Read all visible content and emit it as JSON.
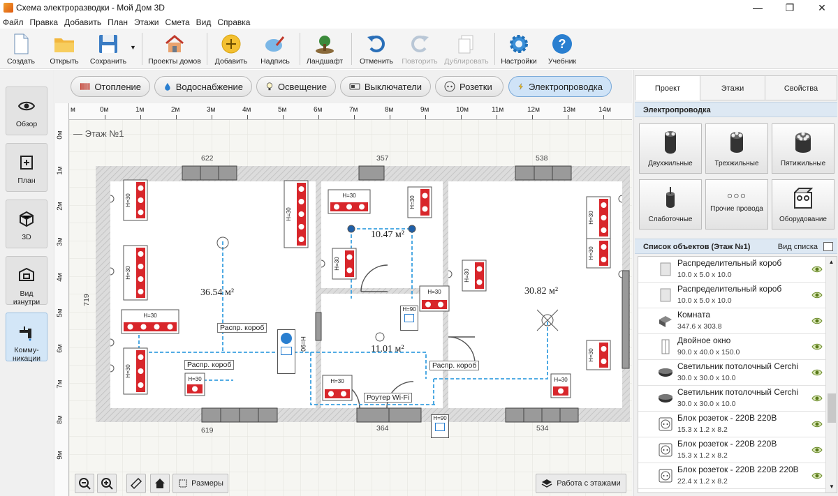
{
  "window": {
    "title": "Схема электроразводки - Мой Дом 3D",
    "minimize": "—",
    "maximize": "❐",
    "close": "✕"
  },
  "menu": [
    "Файл",
    "Правка",
    "Добавить",
    "План",
    "Этажи",
    "Смета",
    "Вид",
    "Справка"
  ],
  "toolbar": {
    "create": "Создать",
    "open": "Открыть",
    "save": "Сохранить",
    "projects": "Проекты домов",
    "add": "Добавить",
    "label": "Надпись",
    "landscape": "Ландшафт",
    "undo": "Отменить",
    "redo": "Повторить",
    "duplicate": "Дублировать",
    "settings": "Настройки",
    "tutorial": "Учебник"
  },
  "leftbar": {
    "overview": "Обзор",
    "plan": "План",
    "three_d": "3D",
    "inside_view": "Вид изнутри",
    "communications": "Комму-никации"
  },
  "categories": {
    "heating": "Отопление",
    "water": "Водоснабжение",
    "lighting": "Освещение",
    "switches": "Выключатели",
    "sockets": "Розетки",
    "wiring": "Электропроводка"
  },
  "ruler": {
    "unit": "м",
    "top": [
      "0м",
      "1м",
      "2м",
      "3м",
      "4м",
      "5м",
      "6м",
      "7м",
      "8м",
      "9м",
      "10м",
      "11м",
      "12м",
      "13м",
      "14м"
    ],
    "left": [
      "0м",
      "1м",
      "2м",
      "3м",
      "4м",
      "5м",
      "6м",
      "7м",
      "8м",
      "9м"
    ]
  },
  "plan": {
    "floor_label": "Этаж №1",
    "dims": {
      "top1": "622",
      "top2": "357",
      "top3": "538",
      "bottom1": "619",
      "bottom2": "364",
      "bottom3": "534",
      "left": "719"
    },
    "areas": [
      "36.54 м²",
      "10.47 м²",
      "11.01 м²",
      "30.82 м²"
    ],
    "box_labels": [
      "Распр. короб",
      "Распр. короб",
      "Распр. короб"
    ],
    "router_label": "Роутер Wi-Fi",
    "height_label": "H=30",
    "height_label_90": "H=90"
  },
  "bottom_tools": {
    "sizes": "Размеры",
    "floors_work": "Работа с этажами"
  },
  "right": {
    "tabs": {
      "project": "Проект",
      "floors": "Этажи",
      "properties": "Свойства"
    },
    "section_wiring": "Электропроводка",
    "wires": [
      "Двухжильные",
      "Трехжильные",
      "Пятижильные",
      "Слаботочные",
      "Прочие провода",
      "Оборудование"
    ],
    "list_header": "Список объектов (Этаж №1)",
    "list_view": "Вид списка",
    "objects": [
      {
        "name": "Распределительный короб",
        "dims": "10.0 x 5.0 x 10.0"
      },
      {
        "name": "Распределительный короб",
        "dims": "10.0 x 5.0 x 10.0"
      },
      {
        "name": "Комната",
        "dims": "347.6 x 303.8"
      },
      {
        "name": "Двойное окно",
        "dims": "90.0 x 40.0 x 150.0"
      },
      {
        "name": "Светильник потолочный Cerchi",
        "dims": "30.0 x 30.0 x 10.0"
      },
      {
        "name": "Светильник потолочный Cerchi",
        "dims": "30.0 x 30.0 x 10.0"
      },
      {
        "name": "Блок розеток - 220В 220В",
        "dims": "15.3 x 1.2 x 8.2"
      },
      {
        "name": "Блок розеток - 220В 220В",
        "dims": "15.3 x 1.2 x 8.2"
      },
      {
        "name": "Блок розеток - 220В 220В 220В",
        "dims": "22.4 x 1.2 x 8.2"
      }
    ]
  },
  "colors": {
    "accent": "#2a8ad6",
    "socket_red": "#d8262b",
    "wire_blue": "#3aa0e0",
    "wall": "#cfcfcf"
  }
}
